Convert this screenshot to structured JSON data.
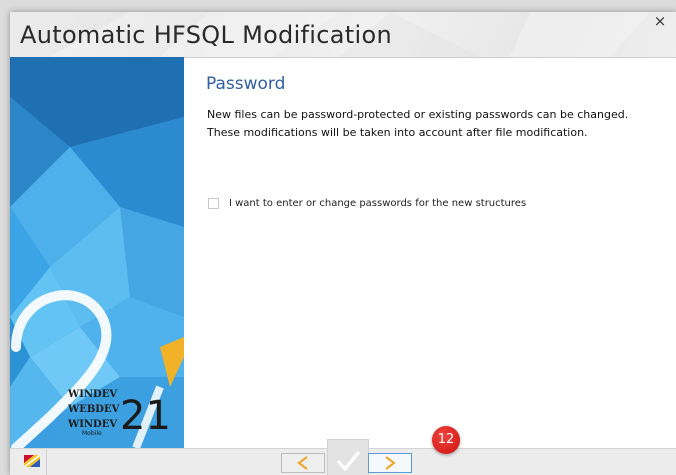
{
  "window": {
    "title": "Automatic HFSQL Modification",
    "close_glyph": "×"
  },
  "sidebar": {
    "brand": {
      "names": [
        "WINDEV",
        "WEBDEV",
        "WINDEV"
      ],
      "mobile_label": "Mobile",
      "version": "21"
    }
  },
  "page": {
    "heading": "Password",
    "description_line1": "New files can be password-protected or existing passwords can be changed.",
    "description_line2": "These modifications will be taken into account after file modification.",
    "checkbox": {
      "label": "I want to enter or change passwords for the new structures",
      "checked": false
    }
  },
  "footer": {
    "language_icon": "flag-icon",
    "prev_icon": "chevron-left-icon",
    "finish_icon": "checkmark-icon",
    "next_icon": "chevron-right-icon",
    "badge": "12"
  },
  "colors": {
    "accent": "#2f5fa0",
    "nav_arrow": "#f0a830",
    "badge": "#e0302c",
    "sidebar_blue": "#3a9ee0"
  }
}
